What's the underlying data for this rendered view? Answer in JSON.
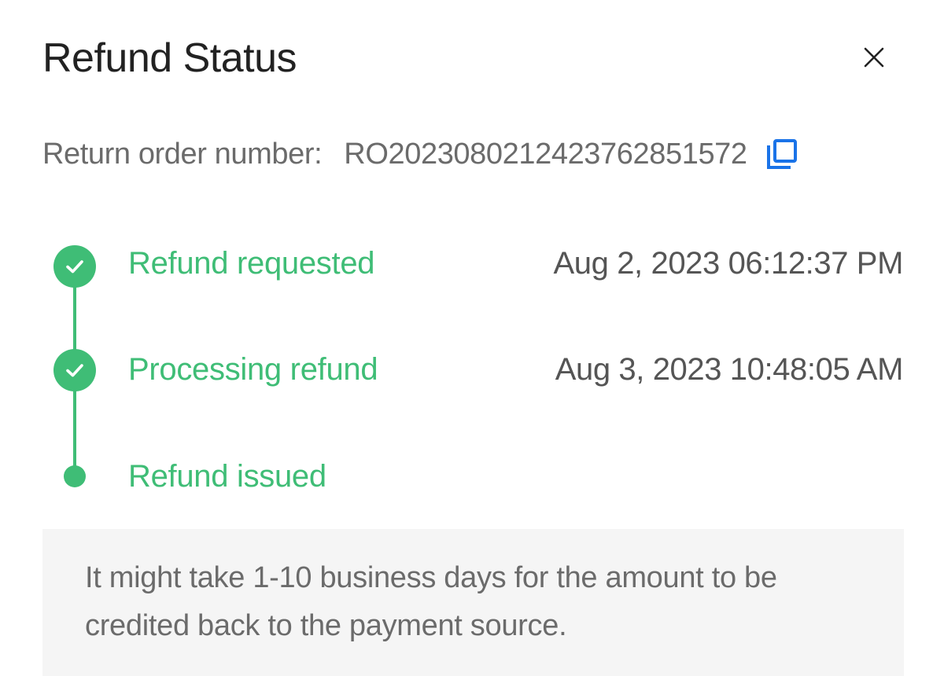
{
  "header": {
    "title": "Refund Status",
    "close_icon": "close-icon"
  },
  "order": {
    "label": "Return order number:",
    "number": "RO202308021242376285​1572",
    "copy_icon": "copy-icon"
  },
  "timeline": {
    "accent_color": "#3fbd76",
    "steps": [
      {
        "label": "Refund requested",
        "time": "Aug 2, 2023 06:12:37 PM",
        "status": "completed",
        "icon": "check-icon"
      },
      {
        "label": "Processing refund",
        "time": "Aug 3, 2023 10:48:05 AM",
        "status": "completed",
        "icon": "check-icon"
      },
      {
        "label": "Refund issued",
        "time": "",
        "status": "pending",
        "icon": "dot-icon"
      }
    ]
  },
  "notice": {
    "text": "It might take 1-10 business days for the amount to be credited back to the payment source."
  }
}
